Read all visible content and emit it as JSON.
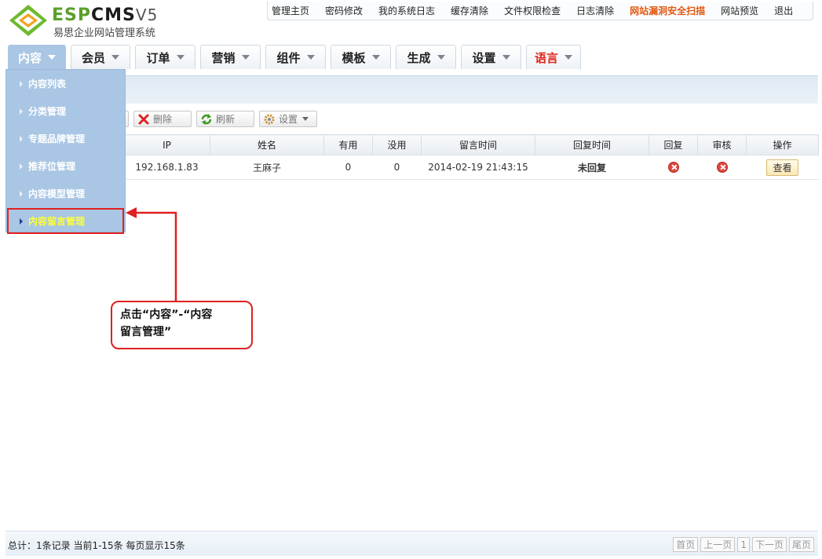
{
  "logo": {
    "esp": "ESP",
    "cms": "CMS",
    "version": "V5",
    "subtitle": "易思企业网站管理系统"
  },
  "toplinks": [
    "管理主页",
    "密码修改",
    "我的系统日志",
    "缓存清除",
    "文件权限检查",
    "日志清除",
    "网站漏洞安全扫描",
    "网站预览",
    "退出"
  ],
  "nav": [
    "内容",
    "会员",
    "订单",
    "营销",
    "组件",
    "模板",
    "生成",
    "设置",
    "语言"
  ],
  "dropdown": [
    "内容列表",
    "分类管理",
    "专题品牌管理",
    "推荐位管理",
    "内容模型管理",
    "内容留言管理"
  ],
  "toolbar": {
    "delete": "删除",
    "refresh": "刷新",
    "settings": "设置"
  },
  "table": {
    "headers": [
      "IP",
      "姓名",
      "有用",
      "没用",
      "留言时间",
      "回复时间",
      "回复",
      "审核",
      "操作"
    ],
    "rows": [
      {
        "ip": "192.168.1.83",
        "name": "王麻子",
        "useful": "0",
        "useless": "0",
        "time": "2014-02-19 21:43:15",
        "reply_time": "未回复",
        "action": "查看"
      }
    ]
  },
  "callout": {
    "line1": "点击“内容”-“内容",
    "line2": "留言管理”"
  },
  "footer": {
    "total": "总计：1条记录 当前1-15条 每页显示15条",
    "pager": [
      "首页",
      "上一页",
      "1",
      "下一页",
      "尾页"
    ]
  },
  "colors": {
    "accent": "#a9c6e4",
    "highlight": "#e02020",
    "hot": "#e15a13"
  }
}
